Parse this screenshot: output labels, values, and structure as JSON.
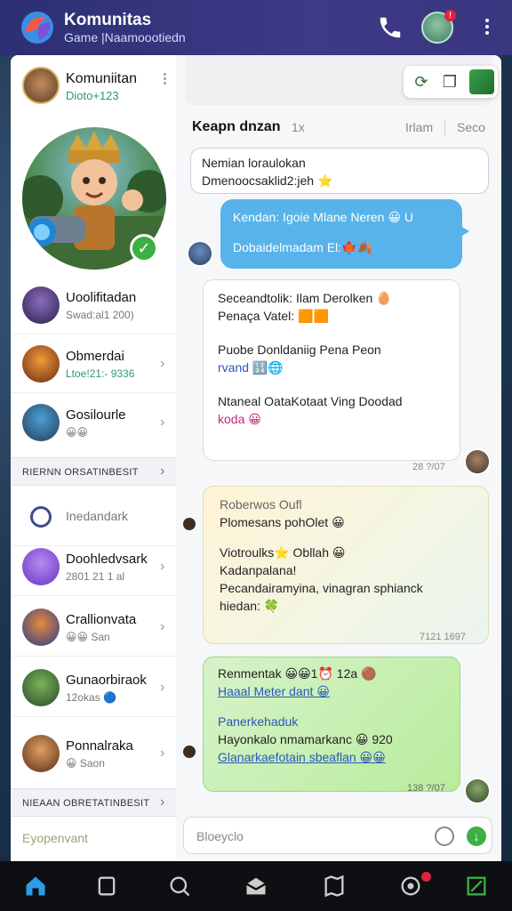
{
  "header": {
    "title": "Komunitas",
    "subtitle": "Game |Naamoootiedn"
  },
  "profile": {
    "name": "Komuniitan",
    "sub": "Dioto+123"
  },
  "sidebar": {
    "items": [
      {
        "name": "Uoolifitadan",
        "sub": "Swad:al1 200)"
      },
      {
        "name": "Obmerdai",
        "sub": "Ltoe!21:- 9336"
      },
      {
        "name": "Gosilourle",
        "sub": "😀😀"
      }
    ],
    "section1": "RIERNN ORSATINBESIT",
    "dark_item": "Inedandark",
    "items2": [
      {
        "name": "Doohledvsark",
        "sub": "2801 21 1 al"
      },
      {
        "name": "Crallionvata",
        "sub": "😀😀 San"
      },
      {
        "name": "Gunaorbiraok",
        "sub": "12okas 🔵"
      },
      {
        "name": "Ponnalraka",
        "sub": "😀 Saon"
      }
    ],
    "section2": "NIEAAN OBRETATINBESIT",
    "footer": "Eyopenvant"
  },
  "chat": {
    "tabs": {
      "active": "Keapn dnzan",
      "count": "1x",
      "right1": "Irlam",
      "right2": "Seco"
    },
    "msg1": {
      "line1": "Nemian loraulokan",
      "line2": "Dmenoocsaklid2:jeh ⭐"
    },
    "msg2": {
      "line1": "Kendan: Igoie Mlane Neren 😀 U",
      "line2": "Dobaidelmadam El:🍁🍂"
    },
    "msg3": {
      "line1": "Seceandtolik: Ilam Derolken 🥚",
      "line2": "Penaça Vatel: 🟧🟧",
      "line3": "Puobe Donldaniig Pena Peon",
      "line4": "rvand 🔢🌐",
      "line5": "Ntaneal OataKotaat Ving Doodad",
      "line6": "koda 😀",
      "time": "28 ?/07"
    },
    "msg4": {
      "line1": "Roberwos Oufl",
      "line2": "Plomesans pohOlet 😀",
      "line3": "Viotroulks⭐ Obllah 😀",
      "line4": "Kadanpalana!",
      "line5": "Pecandairamyina, vinagran sphianck",
      "line6": "hiedan: 🍀",
      "time": "7121 1697"
    },
    "msg5": {
      "line1": "Renmentak 😀😀1⏰ 12a 🟤",
      "line2": "Haaal Meter dant 😀",
      "line3": "Panerkehaduk",
      "line4": "Hayonkalo nmamarkanc 😀 920",
      "line5": "Glanarkaefotain sbeaflan 😀😀",
      "time": "138 ?/07"
    },
    "composer_placeholder": "Bloeyclo"
  },
  "colors": {
    "header": "#2c2f73",
    "accent": "#3cb043",
    "bubble_blue": "#57b3e9",
    "bubble_green": "#b9ec9d"
  }
}
